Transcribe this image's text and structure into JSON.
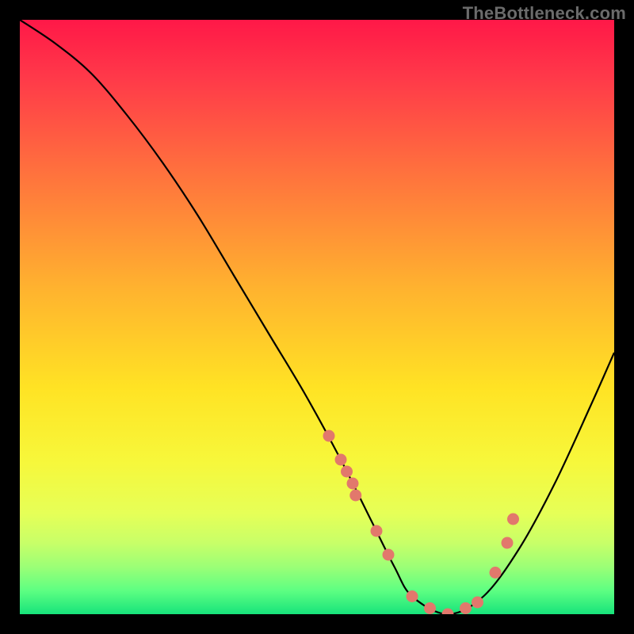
{
  "watermark": "TheBottleneck.com",
  "chart_data": {
    "type": "line",
    "title": "",
    "xlabel": "",
    "ylabel": "",
    "xlim": [
      0,
      100
    ],
    "ylim": [
      0,
      100
    ],
    "grid": false,
    "legend": "none",
    "series": [
      {
        "name": "bottleneck-curve",
        "x": [
          0,
          6,
          12,
          18,
          24,
          30,
          36,
          42,
          48,
          54,
          59,
          63,
          66,
          72,
          78,
          84,
          90,
          96,
          100
        ],
        "y": [
          100,
          96,
          91,
          84,
          76,
          67,
          57,
          47,
          37,
          26,
          16,
          8,
          3,
          0,
          3,
          11,
          22,
          35,
          44
        ]
      }
    ],
    "highlight_points": {
      "name": "highlighted-scatter",
      "x": [
        52,
        54,
        55,
        56,
        56.5,
        60,
        62,
        66,
        69,
        72,
        75,
        77,
        80,
        82,
        83
      ],
      "y": [
        30,
        26,
        24,
        22,
        20,
        14,
        10,
        3,
        1,
        0,
        1,
        2,
        7,
        12,
        16
      ]
    }
  }
}
